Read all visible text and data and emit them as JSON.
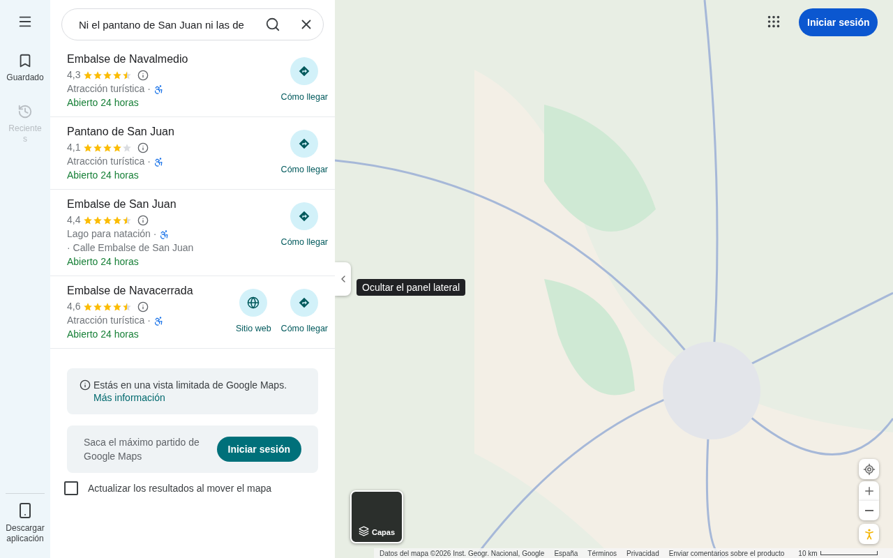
{
  "rail": {
    "items": [
      {
        "kind": "saved",
        "label": "Guardado",
        "disabled": false
      },
      {
        "kind": "recent",
        "label": "Reciente\ns",
        "disabled": true
      }
    ],
    "download": {
      "label": "Descargar aplicación"
    }
  },
  "search": {
    "value": "Ni el pantano de San Juan ni las de"
  },
  "results": [
    {
      "name": "Embalse de Navalmedio",
      "rating": "4,3",
      "stars": 4.5,
      "category": "Atracción turística ·",
      "hours": "Abierto 24 horas",
      "actions": [
        {
          "kind": "directions",
          "label": "Cómo llegar"
        }
      ]
    },
    {
      "name": "Pantano de San Juan",
      "rating": "4,1",
      "stars": 4,
      "category": "Atracción turística ·",
      "hours": "Abierto 24 horas",
      "actions": [
        {
          "kind": "directions",
          "label": "Cómo llegar"
        }
      ]
    },
    {
      "name": "Embalse de San Juan",
      "rating": "4,4",
      "stars": 4.5,
      "category": "Lago para natación ·",
      "address": "· Calle Embalse de San Juan",
      "hours": "Abierto 24 horas",
      "actions": [
        {
          "kind": "directions",
          "label": "Cómo llegar"
        }
      ]
    },
    {
      "name": "Embalse de Navacerrada",
      "rating": "4,6",
      "stars": 4.5,
      "category": "Atracción turística ·",
      "hours": "Abierto 24 horas",
      "actions": [
        {
          "kind": "website",
          "label": "Sitio web"
        },
        {
          "kind": "directions",
          "label": "Cómo llegar"
        }
      ]
    }
  ],
  "notice": {
    "text": "Estás en una vista limitada de Google Maps.",
    "link": "Más información"
  },
  "promo": {
    "text": "Saca el máximo partido de Google Maps",
    "button": "Iniciar sesión"
  },
  "update_on_move": {
    "label": "Actualizar los resultados al mover el mapa",
    "checked": false
  },
  "map": {
    "sign_in": "Iniciar sesión",
    "tooltip": "Ocultar el panel lateral",
    "layers": "Capas",
    "footer": [
      "Datos del mapa ©2026 Inst. Geogr. Nacional, Google",
      "España",
      "Términos",
      "Privacidad",
      "Enviar comentarios sobre el producto"
    ],
    "scale": "10 km"
  }
}
